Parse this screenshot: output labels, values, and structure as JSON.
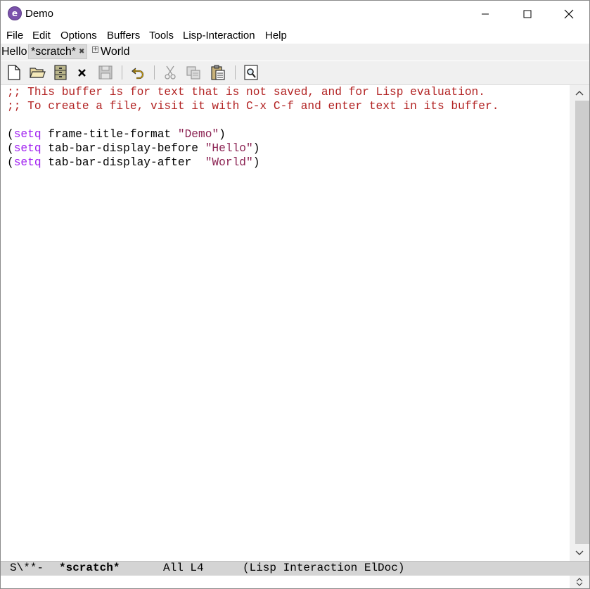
{
  "window": {
    "title": "Demo"
  },
  "menubar": {
    "items": [
      "File",
      "Edit",
      "Options",
      "Buffers",
      "Tools",
      "Lisp-Interaction",
      "Help"
    ]
  },
  "tabbar": {
    "before": "Hello",
    "current_tab": "*scratch*",
    "after": "World"
  },
  "toolbar": {
    "icons": [
      "new-file-icon",
      "open-folder-icon",
      "dired-icon",
      "close-buffer-icon",
      "save-icon",
      "undo-icon",
      "cut-icon",
      "copy-icon",
      "paste-icon",
      "search-icon"
    ]
  },
  "buffer": {
    "lines": [
      {
        "parts": [
          {
            "text": ";; This buffer is for text that is not saved, and for Lisp evaluation.",
            "face": "comment"
          }
        ]
      },
      {
        "parts": [
          {
            "text": ";; To create a file, visit it with C-x C-f and enter text in its buffer.",
            "face": "comment"
          }
        ]
      },
      {
        "parts": []
      },
      {
        "parts": [
          {
            "text": "(",
            "face": "plain"
          },
          {
            "text": "setq",
            "face": "kw"
          },
          {
            "text": " frame-title-format ",
            "face": "plain"
          },
          {
            "text": "\"Demo\"",
            "face": "str"
          },
          {
            "text": ")",
            "face": "plain"
          }
        ]
      },
      {
        "parts": [
          {
            "text": "(",
            "face": "plain"
          },
          {
            "text": "setq",
            "face": "kw"
          },
          {
            "text": " tab-bar-display-before ",
            "face": "plain"
          },
          {
            "text": "\"Hello\"",
            "face": "str"
          },
          {
            "text": ")",
            "face": "plain"
          }
        ]
      },
      {
        "parts": [
          {
            "text": "(",
            "face": "plain"
          },
          {
            "text": "setq",
            "face": "kw"
          },
          {
            "text": " tab-bar-display-after  ",
            "face": "plain"
          },
          {
            "text": "\"World\"",
            "face": "str"
          },
          {
            "text": ")",
            "face": "plain"
          }
        ]
      }
    ]
  },
  "modeline": {
    "status": "S\\**-",
    "buffer_name": "*scratch*",
    "position": "All L4",
    "modes": "(Lisp Interaction ElDoc)"
  },
  "colors": {
    "comment": "#b22222",
    "keyword": "#a020f0",
    "string": "#8b2252",
    "modeline_bg": "#d4d4d4",
    "app_icon": "#7b52ab"
  }
}
